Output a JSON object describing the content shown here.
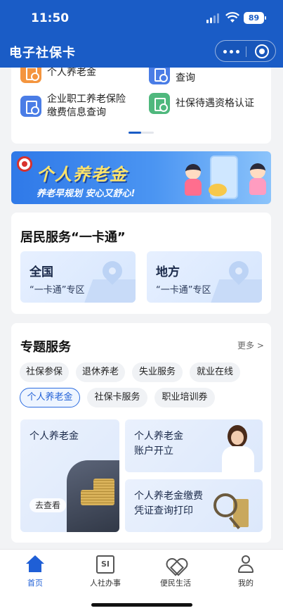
{
  "status_bar": {
    "time": "11:50",
    "battery": "89"
  },
  "app_bar": {
    "title": "电子社保卡"
  },
  "services_grid": {
    "items": [
      {
        "label": "个人养老金",
        "icon": "pension-icon",
        "color": "#f4953f"
      },
      {
        "label": "查询",
        "icon": "query-icon",
        "color": "#4a7de6"
      },
      {
        "label": "企业职工养老保险\n缴费信息查询",
        "line1": "企业职工养老保险",
        "line2": "缴费信息查询",
        "icon": "document-search-icon",
        "color": "#4a7de6"
      },
      {
        "label": "社保待遇资格认证",
        "icon": "shield-check-icon",
        "color": "#4fb87d"
      }
    ]
  },
  "banner": {
    "title": "个人养老金",
    "subtitle": "养老早规划 安心又舒心!"
  },
  "one_card": {
    "title": "居民服务“一卡通”",
    "zones": [
      {
        "title": "全国",
        "subtitle": "“一卡通”专区"
      },
      {
        "title": "地方",
        "subtitle": "“一卡通”专区"
      }
    ]
  },
  "topics": {
    "title": "专题服务",
    "more": "更多 >",
    "chips": [
      "社保参保",
      "退休养老",
      "失业服务",
      "就业在线",
      "个人养老金",
      "社保卡服务",
      "职业培训券"
    ],
    "active_chip": "个人养老金",
    "tiles": [
      {
        "line1": "个人养老金",
        "button": "去查看"
      },
      {
        "line1": "个人养老金",
        "line2": "账户开立"
      },
      {
        "line1": "个人养老金缴费",
        "line2": "凭证查询打印"
      }
    ]
  },
  "tabbar": {
    "tabs": [
      {
        "label": "首页",
        "active": true,
        "icon": "home-icon"
      },
      {
        "label": "人社办事",
        "active": false,
        "icon": "si-icon"
      },
      {
        "label": "便民生活",
        "active": false,
        "icon": "heart-hands-icon"
      },
      {
        "label": "我的",
        "active": false,
        "icon": "person-icon"
      }
    ]
  },
  "colors": {
    "primary": "#1a5cc6",
    "accent": "#1f5fd6",
    "background": "#f2f3f5"
  }
}
